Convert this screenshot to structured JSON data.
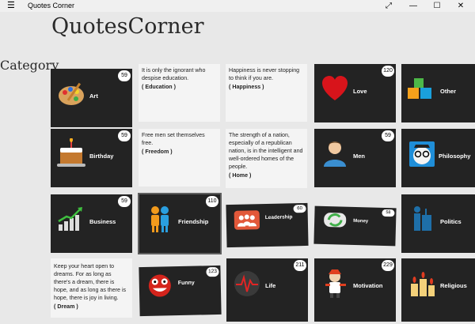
{
  "window": {
    "title": "Quotes Corner",
    "menu_icon": "hamburger-icon",
    "buttons": [
      "expand-icon",
      "minimize-icon",
      "maximize-icon",
      "close-icon"
    ]
  },
  "app": {
    "title": "QuotesCorner",
    "category_heading": "Category"
  },
  "categories": [
    {
      "label": "Art",
      "count": "59",
      "icon": "palette-icon"
    },
    {
      "label": "Love",
      "count": "120",
      "icon": "heart-icon"
    },
    {
      "label": "Other",
      "count": "",
      "icon": "blocks-icon"
    },
    {
      "label": "Birthday",
      "count": "59",
      "icon": "cake-icon"
    },
    {
      "label": "Men",
      "count": "59",
      "icon": "man-icon"
    },
    {
      "label": "Philosophy",
      "count": "",
      "icon": "glasses-face-icon"
    },
    {
      "label": "Business",
      "count": "59",
      "icon": "bar-growth-icon"
    },
    {
      "label": "Friendship",
      "count": "110",
      "icon": "friends-icon"
    },
    {
      "label": "Leadership",
      "count": "60",
      "icon": "team-icon"
    },
    {
      "label": "Money",
      "count": "58",
      "icon": "money-icon"
    },
    {
      "label": "Politics",
      "count": "",
      "icon": "politician-icon"
    },
    {
      "label": "Funny",
      "count": "123",
      "icon": "funny-face-icon"
    },
    {
      "label": "Life",
      "count": "211",
      "icon": "heartbeat-icon"
    },
    {
      "label": "Motivation",
      "count": "229",
      "icon": "mascot-icon"
    },
    {
      "label": "Religious",
      "count": "",
      "icon": "candles-icon"
    }
  ],
  "quotes": [
    {
      "text": "It is only the ignorant who despise education.",
      "category": "( Education )"
    },
    {
      "text": "Happiness is never stopping to think if you are.",
      "category": "( Happiness )"
    },
    {
      "text": "Free men set themselves free.",
      "category": "( Freedom )"
    },
    {
      "text": "The strength of a nation, especially of a republican nation, is in the intelligent and well-ordered homes of the people.",
      "category": "( Home )"
    },
    {
      "text": "Keep your heart open to dreams. For as long as there's a dream, there is hope, and as long as there is hope, there is joy in living.",
      "category": "( Dream )"
    }
  ]
}
